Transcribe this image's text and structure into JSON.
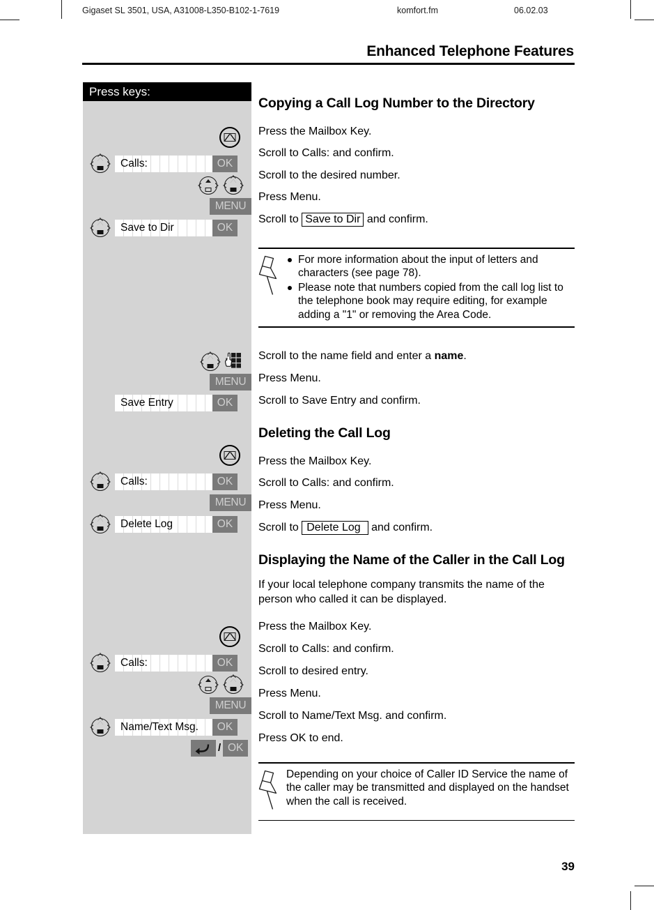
{
  "header": {
    "doc_id": "Gigaset SL 3501, USA, A31008-L350-B102-1-7619",
    "file_name": "komfort.fm",
    "date": "06.02.03"
  },
  "chapter_title": "Enhanced Telephone Features",
  "page_number": "39",
  "sidebar": {
    "heading": "Press keys:",
    "labels": {
      "calls": "Calls:",
      "save_to_dir": "Save to Dir",
      "save_entry": "Save Entry",
      "delete_log": "Delete Log",
      "name_text_msg": "Name/Text Msg.",
      "ok": "OK",
      "menu": "MENU",
      "slash": "/"
    }
  },
  "sections": [
    {
      "title": "Copying a Call Log Number to the Directory",
      "steps": [
        "Press the Mailbox Key.",
        "Scroll to Calls: and confirm.",
        "Scroll to the desired number.",
        "Press Menu."
      ],
      "step_boxed_prefix": "Scroll to ",
      "step_boxed_value": "Save to Dir",
      "step_boxed_suffix": " and confirm."
    },
    {
      "title": "Deleting the Call Log",
      "steps": [
        "Press the Mailbox Key.",
        "Scroll to Calls: and confirm.",
        "Press Menu."
      ],
      "step_boxed_prefix": "Scroll to ",
      "step_boxed_value": "Delete Log",
      "step_boxed_suffix": " and confirm."
    },
    {
      "title": "Displaying the Name of the Caller in the Call Log",
      "intro": "If your local telephone company transmits the name of the person who called it can be displayed.",
      "steps": [
        "Press the Mailbox Key.",
        "Scroll to Calls: and confirm.",
        "Scroll to desired entry.",
        "Press Menu.",
        "Scroll to Name/Text Msg. and confirm.",
        "Press OK to end."
      ]
    }
  ],
  "mid_steps": {
    "name_field_pre": "Scroll to the name field and enter a ",
    "name_field_bold": "name",
    "name_field_post": ".",
    "press_menu": "Press Menu.",
    "save_entry": "Scroll to Save Entry and confirm."
  },
  "notes": [
    {
      "bullets": [
        "For more information about the input of letters and characters (see page 78).",
        "Please note that numbers copied from the call log list to the telephone book may require editing, for example adding a \"1\" or removing the Area Code."
      ]
    },
    {
      "text": "Depending on your choice of Caller ID Service the name of the caller may be transmitted and displayed on the handset when the call is received."
    }
  ],
  "colors": {
    "sidebar_bg": "#d4d4d4",
    "softkey_bg": "#7a7a7a",
    "softkey_fg": "#cfcfcf",
    "heading_bg": "#000000"
  }
}
